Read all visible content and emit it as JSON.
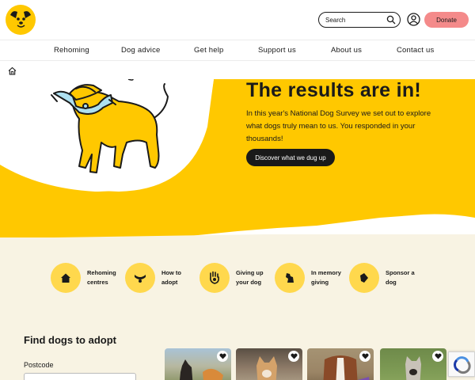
{
  "header": {
    "search": {
      "placeholder": "Search"
    },
    "donate_label": "Donate"
  },
  "nav": {
    "items": [
      {
        "label": "Rehoming"
      },
      {
        "label": "Dog advice"
      },
      {
        "label": "Get help"
      },
      {
        "label": "Support us"
      },
      {
        "label": "About us"
      },
      {
        "label": "Contact us"
      }
    ]
  },
  "hero": {
    "title": "The results are in!",
    "text": "In this year's National Dog Survey we set out to explore what dogs truly mean to us. You responded in your thousands!",
    "button_label": "Discover what we dug up"
  },
  "services": [
    {
      "label": "Rehoming centres",
      "icon": "house-icon"
    },
    {
      "label": "How to adopt",
      "icon": "collar-icon"
    },
    {
      "label": "Giving up your dog",
      "icon": "hand-paw-icon"
    },
    {
      "label": "In memory giving",
      "icon": "dog-sitting-icon"
    },
    {
      "label": "Sponsor a dog",
      "icon": "sponsor-icon"
    }
  ],
  "find_dogs": {
    "title": "Find dogs to adopt",
    "postcode_label": "Postcode"
  },
  "colors": {
    "brand_yellow": "#ffc800",
    "light_yellow": "#ffd84d",
    "donate_pink": "#f48a8a",
    "cream": "#f8f3e3",
    "dark": "#1a1a1a"
  }
}
